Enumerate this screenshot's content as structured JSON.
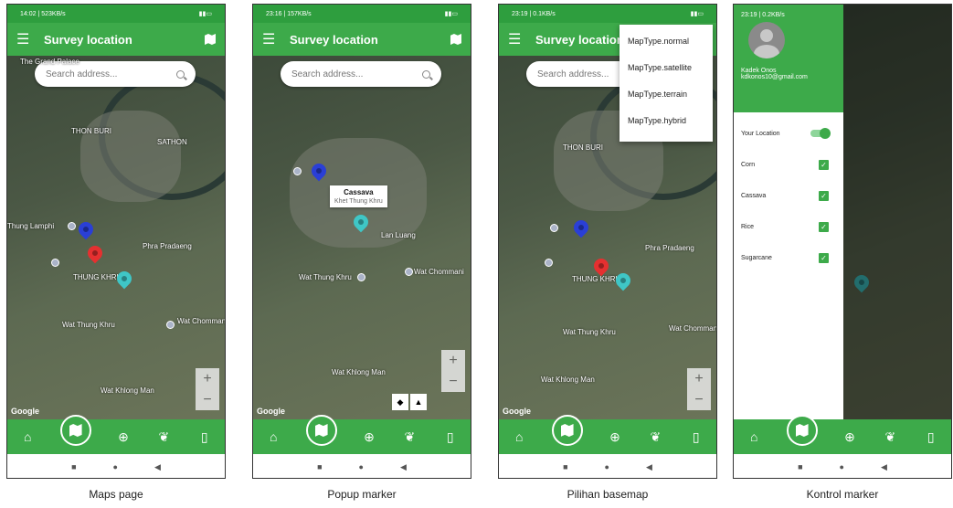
{
  "screens": [
    {
      "status_time": "14:02 | 523KB/s",
      "title": "Survey location",
      "search_placeholder": "Search address...",
      "caption": "Maps page",
      "labels": [
        "The Grand Palace",
        "THON BURI",
        "SATHON",
        "Thung Lamphi",
        "Phra Pradaeng",
        "THUNG KHRU",
        "Wat Thung Khru",
        "Wat Khlong Man",
        "Wat Chommani"
      ],
      "google": "Google"
    },
    {
      "status_time": "23:16 | 157KB/s",
      "title": "Survey location",
      "search_placeholder": "Search address...",
      "caption": "Popup marker",
      "popup_title": "Cassava",
      "popup_subtitle": "Khet Thung Khru",
      "labels": [
        "Wat Thung Khru",
        "Wat Khlong Man",
        "Wat Chommani",
        "Lan Luang",
        "Khet Thung Khru"
      ],
      "google": "Google"
    },
    {
      "status_time": "23:19 | 0.1KB/s",
      "title": "Survey location",
      "search_placeholder": "Search address...",
      "caption": "Pilihan basemap",
      "menu_items": [
        "MapType.normal",
        "MapType.satellite",
        "MapType.terrain",
        "MapType.hybrid"
      ],
      "labels": [
        "THON BURI",
        "Phra Pradaeng",
        "THUNG KHRU",
        "Wat Thung Khru",
        "Wat Khlong Man",
        "Wat Chommani"
      ],
      "google": "Google"
    },
    {
      "status_time": "23:19 | 0.2KB/s",
      "caption": "Kontrol marker",
      "user_name": "Kadek Onos",
      "user_email": "kdkonos10@gmail.com",
      "drawer_items": [
        "Your Location",
        "Corn",
        "Cassava",
        "Rice",
        "Sugarcane"
      ]
    }
  ],
  "colors": {
    "primary": "#3daa4a",
    "status": "#2e9e3e"
  }
}
